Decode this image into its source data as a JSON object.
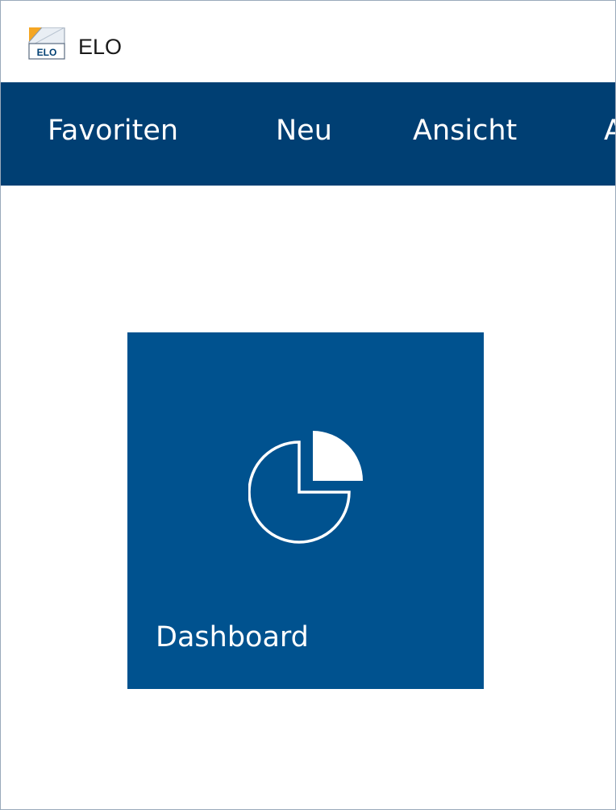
{
  "window": {
    "title": "ELO",
    "app_icon": "elo-app-icon",
    "app_icon_text": "ELO"
  },
  "menubar": {
    "background": "#003f73",
    "items": [
      {
        "label": "Favoriten"
      },
      {
        "label": "Neu"
      },
      {
        "label": "Ansicht"
      },
      {
        "label": "A"
      }
    ]
  },
  "tiles": [
    {
      "label": "Dashboard",
      "icon": "pie-chart-icon",
      "background": "#00528f"
    }
  ]
}
